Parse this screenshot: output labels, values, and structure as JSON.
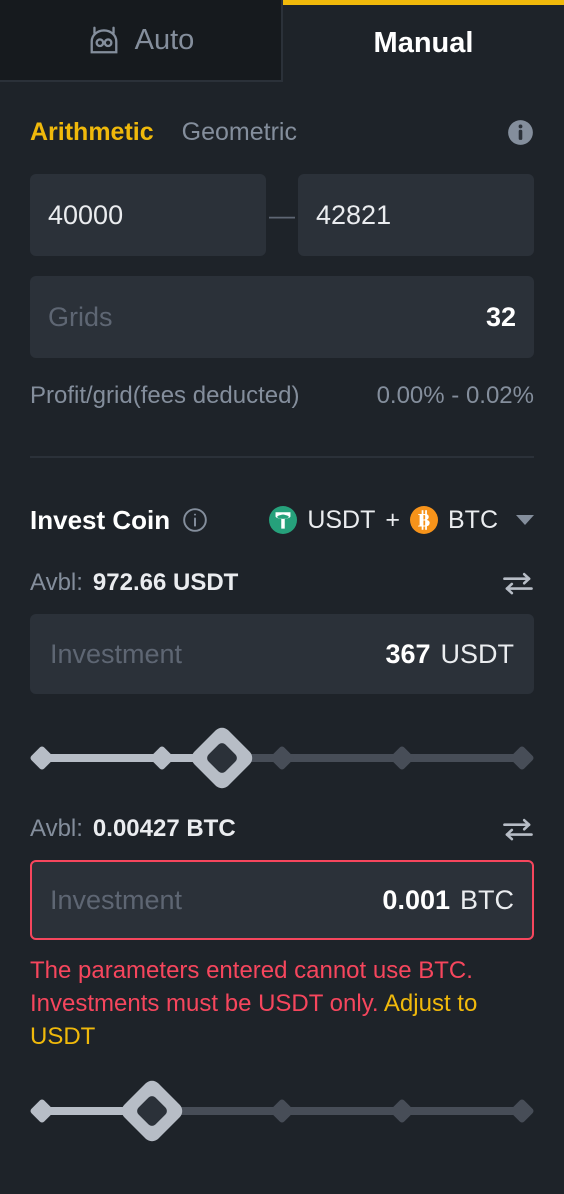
{
  "tabs": [
    {
      "label": "Auto",
      "icon": "robot-icon",
      "active": false
    },
    {
      "label": "Manual",
      "icon": "",
      "active": true
    }
  ],
  "mode": {
    "arithmetic": "Arithmetic",
    "geometric": "Geometric",
    "selected": "Arithmetic",
    "info_icon": "info-icon"
  },
  "price_range": {
    "lower": "40000",
    "upper": "42821",
    "separator": "—"
  },
  "grids": {
    "placeholder": "Grids",
    "value": "32"
  },
  "profit": {
    "label": "Profit/grid(fees deducted)",
    "value": "0.00% - 0.02%"
  },
  "invest_coin": {
    "title": "Invest Coin",
    "info_icon": "info-icon",
    "coin_a": "USDT",
    "plus": "+",
    "coin_b": "BTC",
    "caret_icon": "chevron-down-icon"
  },
  "usdt": {
    "avbl_label": "Avbl:",
    "avbl_value": "972.66 USDT",
    "swap_icon": "swap-icon",
    "placeholder": "Investment",
    "amount": "367",
    "unit": "USDT",
    "slider_percent": 37.5,
    "slider_ticks": [
      0,
      25,
      50,
      75,
      100
    ]
  },
  "btc": {
    "avbl_label": "Avbl:",
    "avbl_value": "0.00427 BTC",
    "swap_icon": "swap-icon",
    "placeholder": "Investment",
    "amount": "0.001",
    "unit": "BTC",
    "slider_percent": 23,
    "slider_ticks": [
      0,
      25,
      50,
      75,
      100
    ],
    "error": true
  },
  "error_message": {
    "text": "The parameters entered cannot use BTC. Investments must be USDT only. ",
    "link": "Adjust to USDT"
  },
  "colors": {
    "accent_gold": "#F0B90B",
    "error_red": "#F6465D",
    "bg": "#1E2329",
    "field_bg": "#2B3139",
    "tab_inactive_bg": "#161A1E",
    "text_muted": "#848E9C",
    "usdt_green": "#26A17B",
    "btc_orange": "#F7931A",
    "slider_fill": "#B7BDC6",
    "slider_track": "#474D57"
  }
}
